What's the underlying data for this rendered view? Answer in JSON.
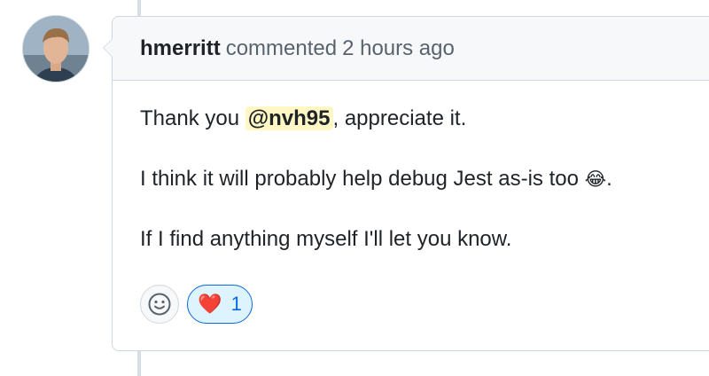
{
  "comment": {
    "author": "hmerritt",
    "action": "commented",
    "time": "2 hours ago",
    "body": {
      "p1_prefix": "Thank you ",
      "mention": "@nvh95",
      "p1_suffix": ", appreciate it.",
      "p2_text": "I think it will probably help debug Jest as-is too ",
      "p2_emoji": "😂",
      "p2_end": ".",
      "p3": "If I find anything myself I'll let you know."
    },
    "reactions": [
      {
        "emoji": "❤️",
        "count": "1"
      }
    ]
  },
  "colors": {
    "mention_bg": "#fff8c5",
    "reaction_accent": "#0969da",
    "reaction_bg": "#ddf4ff",
    "heart": "#e5112b"
  },
  "icons": {
    "add_reaction": "smiley-icon",
    "avatar": "avatar"
  }
}
